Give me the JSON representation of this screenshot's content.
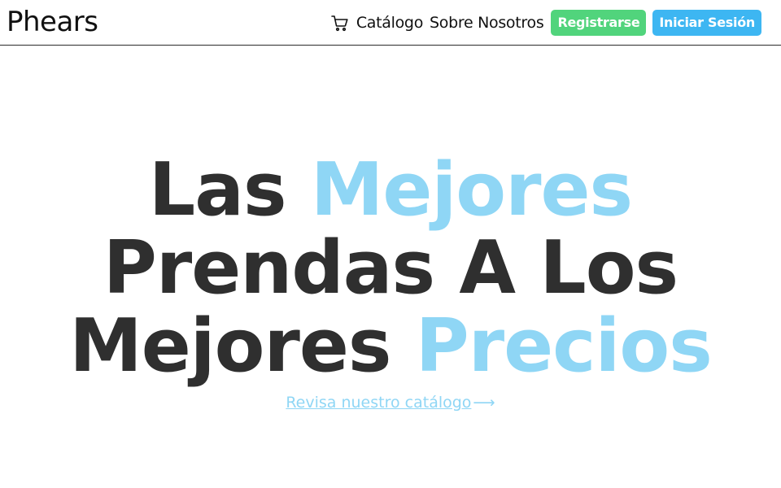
{
  "header": {
    "brand": "Phears",
    "nav": {
      "catalog_icon": "shopping-cart-icon",
      "catalog_label": "Catálogo",
      "about_label": "Sobre Nosotros"
    },
    "buttons": {
      "register_label": "Registrarse",
      "login_label": "Iniciar Sesión"
    }
  },
  "hero": {
    "line1_a": "Las ",
    "line1_b": "Mejores",
    "line2": "Prendas A Los",
    "line3_a": "Mejores ",
    "line3_b": "Precios"
  },
  "cta": {
    "link_label": "Revisa nuestro catálogo",
    "arrow": "⟶"
  },
  "colors": {
    "accent": "#8fd6f5",
    "register": "#51d47c",
    "login": "#3db6f2",
    "text": "#2f2f2f"
  }
}
